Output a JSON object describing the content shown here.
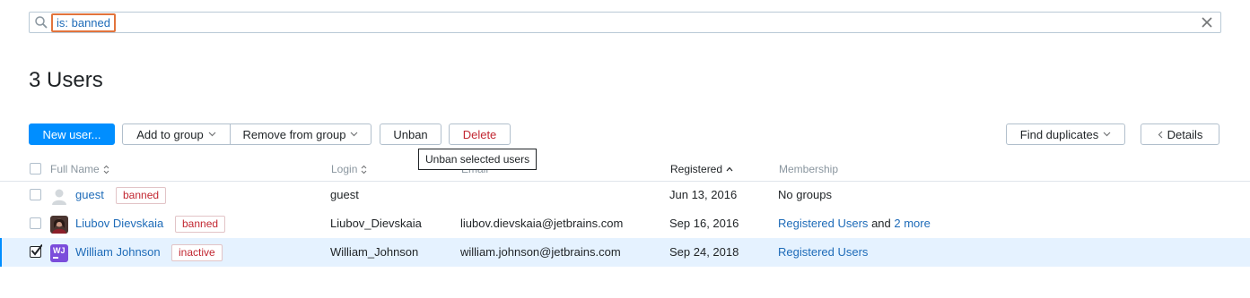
{
  "search": {
    "query": "is: banned"
  },
  "title": "3 Users",
  "toolbar": {
    "new_user": "New user...",
    "add_to_group": "Add to group",
    "remove_from_group": "Remove from group",
    "unban": "Unban",
    "delete": "Delete",
    "find_duplicates": "Find duplicates",
    "details": "Details"
  },
  "tooltip": "Unban selected users",
  "columns": {
    "full_name": "Full Name",
    "login": "Login",
    "email": "Email",
    "registered": "Registered",
    "membership": "Membership"
  },
  "users": [
    {
      "full_name": "guest",
      "status": "banned",
      "login": "guest",
      "email": "",
      "registered": "Jun 13, 2016",
      "membership": "No groups",
      "membership_link": "",
      "membership_and": "",
      "membership_more": "",
      "avatar": "default-avatar-icon",
      "selected": false
    },
    {
      "full_name": "Liubov Dievskaia",
      "status": "banned",
      "login": "Liubov_Dievskaia",
      "email": "liubov.dievskaia@jetbrains.com",
      "registered": "Sep 16, 2016",
      "membership": "",
      "membership_link": "Registered Users",
      "membership_and": "and",
      "membership_more": "2 more",
      "avatar": "photo-avatar",
      "selected": false
    },
    {
      "full_name": "William Johnson",
      "status": "inactive",
      "login": "William_Johnson",
      "email": "william.johnson@jetbrains.com",
      "registered": "Sep 24, 2018",
      "membership": "",
      "membership_link": "Registered Users",
      "membership_and": "",
      "membership_more": "",
      "avatar": "WJ",
      "selected": true
    }
  ],
  "colors": {
    "accent": "#008eff",
    "link": "#1e6bb8",
    "danger": "#c22731",
    "selected_row": "#e5f2ff",
    "search_highlight": "#e2743c"
  }
}
